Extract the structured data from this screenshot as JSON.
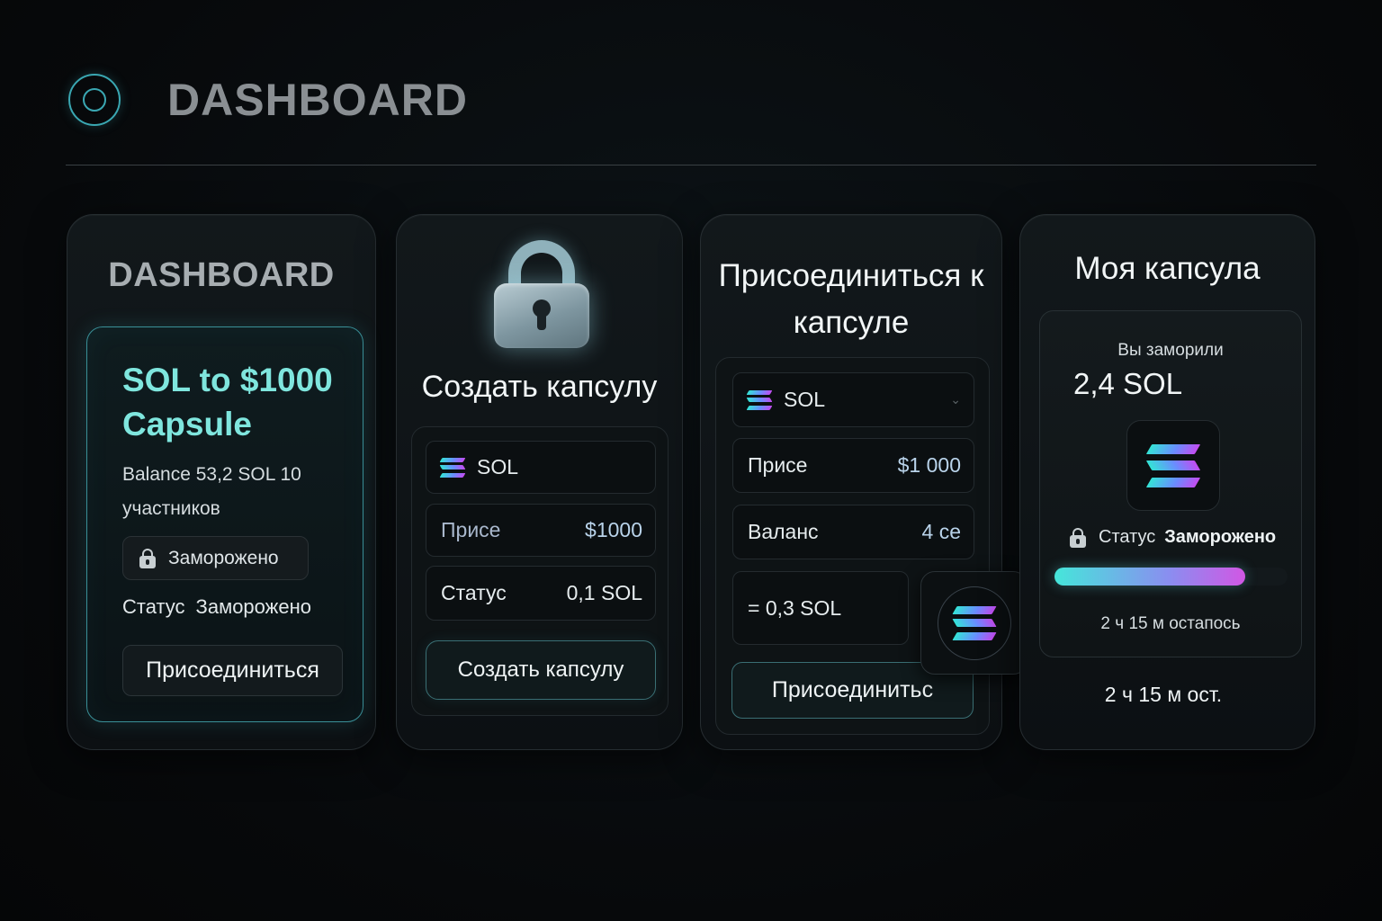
{
  "header": {
    "title": "DASHBOARD",
    "logo_icon": "target-icon"
  },
  "card1": {
    "title": "DASHBOARD",
    "capsule_name": "SOL to $1000 Capsule",
    "balance": "Balance  53,2 SOL 10 участников",
    "frozen_badge": "Заморожено",
    "status_label": "Статус",
    "status_value": "Заморожено",
    "join_button": "Присоединиться"
  },
  "card2": {
    "icon": "lock-icon",
    "title": "Создать капсулу",
    "token": "SOL",
    "price_label": "Присе",
    "price_value": "$1000",
    "status_label": "Статус",
    "status_value": "0,1 SOL",
    "create_button": "Создать капсулу"
  },
  "card3": {
    "title": "Присоединиться к капсуле",
    "token": "SOL",
    "price_label": "Присе",
    "price_value": "$1 000",
    "balance_label": "Валанс",
    "balance_value": "4 се",
    "amount": "= 0,3 SOL",
    "join_button": "Присоединитьс"
  },
  "card4": {
    "title": "Моя капсула",
    "frozen_label": "Вы заморили",
    "frozen_amount": "2,4 SOL",
    "status_label": "Статус",
    "status_value": "Заморожено",
    "progress": 0.82,
    "time_left": "2 ч 15 м остапось",
    "time_short": "2 ч 15 м ост."
  },
  "colors": {
    "accent": "#7fe6de",
    "border_glow": "#3a8f97",
    "gradient_start": "#45e6da",
    "gradient_end": "#d157e4"
  }
}
